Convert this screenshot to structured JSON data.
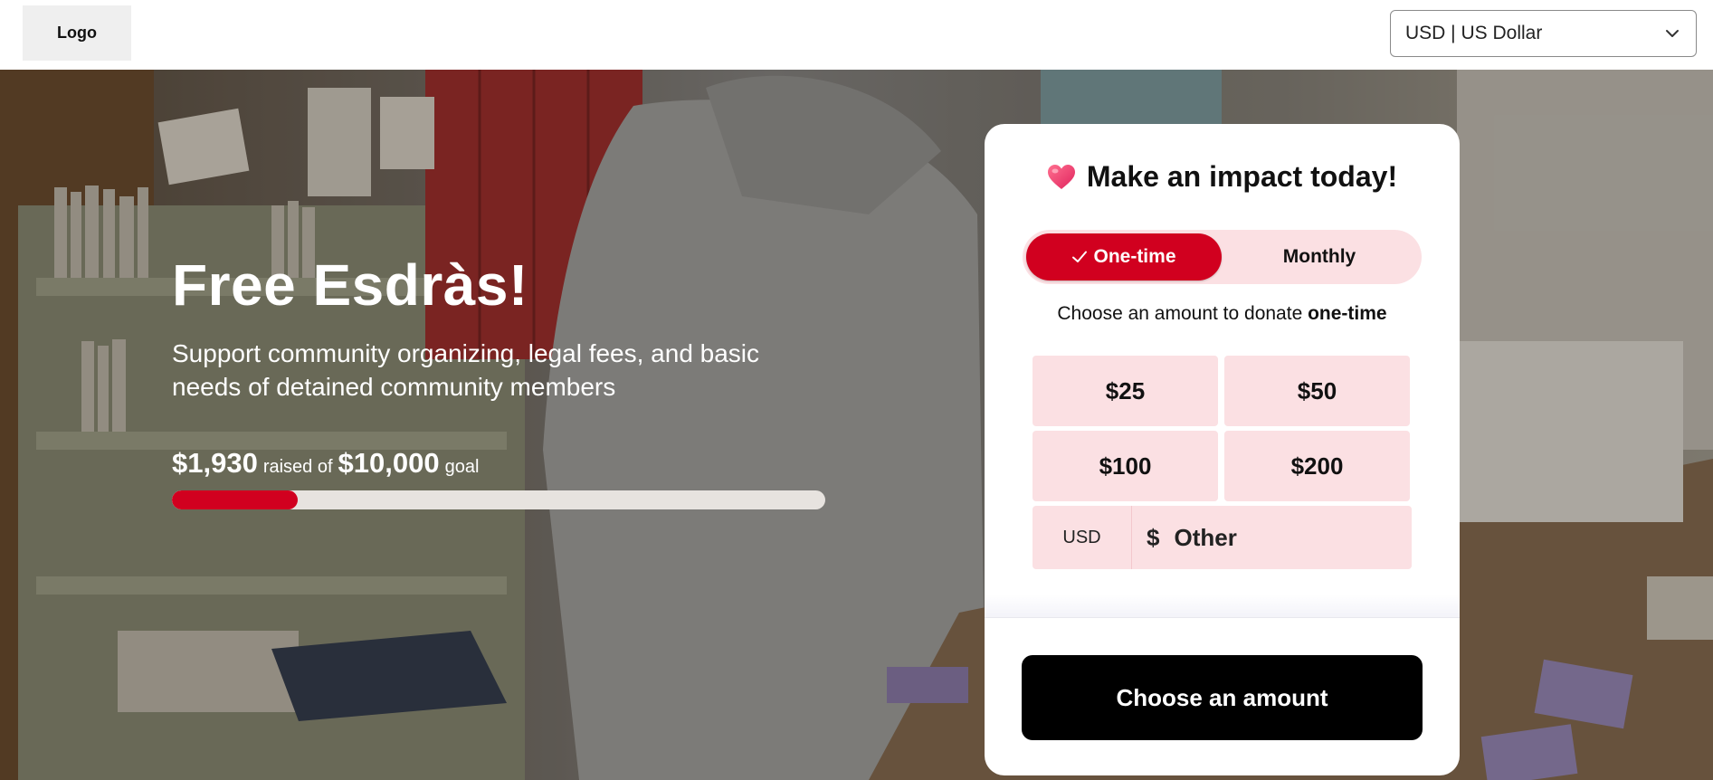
{
  "header": {
    "logo_label": "Logo",
    "currency_selected": "USD | US Dollar"
  },
  "hero": {
    "title": "Free Esdràs!",
    "subtitle": "Support community organizing, legal fees, and basic needs of detained community members",
    "raised_amount": "$1,930",
    "raised_of_text": "raised of",
    "goal_amount": "$10,000",
    "goal_text": "goal",
    "progress_fraction": 0.193
  },
  "donation_card": {
    "title": "Make an impact today!",
    "heart_icon": "heart-icon",
    "frequency": {
      "one_time_label": "One-time",
      "monthly_label": "Monthly",
      "selected": "one-time"
    },
    "choose_text_prefix": "Choose an amount to donate",
    "choose_text_bold": "one-time",
    "amounts": [
      "$25",
      "$50",
      "$100",
      "$200"
    ],
    "other": {
      "currency_label": "USD",
      "currency_symbol": "$",
      "placeholder": "Other"
    },
    "cta_label": "Choose an amount"
  },
  "colors": {
    "accent": "#d1001f",
    "accent_soft": "#fbe0e3",
    "cta_bg": "#000000"
  }
}
